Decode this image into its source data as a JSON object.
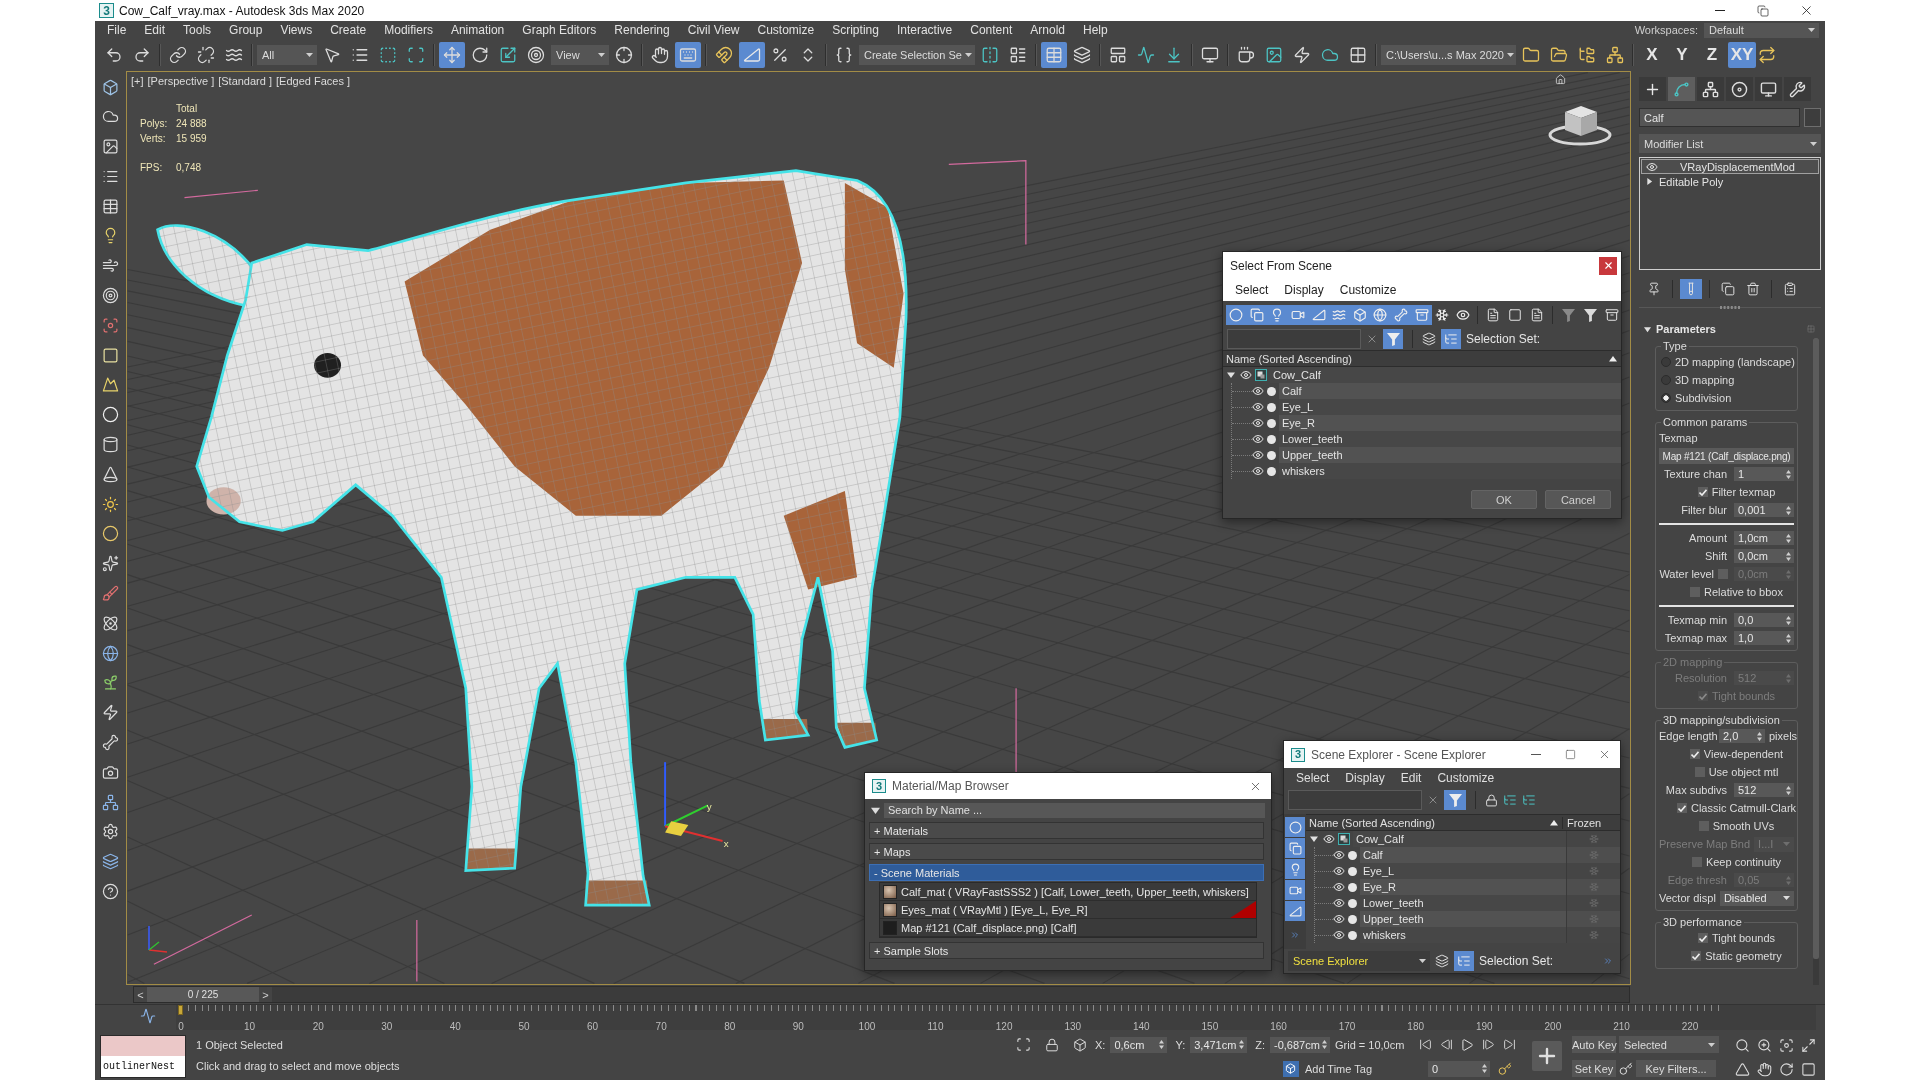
{
  "window": {
    "logo": "3",
    "title": "Cow_Calf_vray.max - Autodesk 3ds Max 2020"
  },
  "menu": [
    "File",
    "Edit",
    "Tools",
    "Group",
    "Views",
    "Create",
    "Modifiers",
    "Animation",
    "Graph Editors",
    "Rendering",
    "Civil View",
    "Customize",
    "Scripting",
    "Interactive",
    "Content",
    "Arnold",
    "Help"
  ],
  "workspaces": {
    "label": "Workspaces:",
    "value": "Default"
  },
  "toolbar": [
    {
      "kind": "button",
      "selected": false
    },
    {
      "kind": "button",
      "selected": false
    },
    {
      "kind": "separator"
    },
    {
      "kind": "button",
      "selected": false
    },
    {
      "kind": "button",
      "selected": false
    },
    {
      "kind": "button",
      "selected": false
    },
    {
      "kind": "separator"
    },
    {
      "kind": "dropdown",
      "value": "All"
    },
    {
      "kind": "button",
      "selected": false
    },
    {
      "kind": "button",
      "selected": false
    },
    {
      "kind": "button",
      "selected": false
    },
    {
      "kind": "button",
      "selected": false
    },
    {
      "kind": "separator"
    },
    {
      "kind": "button",
      "selected": true
    },
    {
      "kind": "button",
      "selected": false
    },
    {
      "kind": "button",
      "selected": false
    },
    {
      "kind": "button",
      "selected": false
    },
    {
      "kind": "dropdown",
      "value": "View"
    },
    {
      "kind": "button",
      "selected": false
    },
    {
      "kind": "separator"
    },
    {
      "kind": "button",
      "selected": false
    },
    {
      "kind": "button",
      "selected": true
    },
    {
      "kind": "separator"
    },
    {
      "kind": "button",
      "selected": false
    },
    {
      "kind": "button",
      "selected": true
    },
    {
      "kind": "button",
      "selected": false
    },
    {
      "kind": "button",
      "selected": false
    },
    {
      "kind": "separator"
    },
    {
      "kind": "button",
      "selected": false
    },
    {
      "kind": "dropdown",
      "value": "Create Selection Se"
    },
    {
      "kind": "button",
      "selected": false
    },
    {
      "kind": "button",
      "selected": false
    },
    {
      "kind": "separator"
    },
    {
      "kind": "button",
      "selected": true
    },
    {
      "kind": "button",
      "selected": false
    },
    {
      "kind": "separator"
    },
    {
      "kind": "button",
      "selected": false
    },
    {
      "kind": "button",
      "selected": false
    },
    {
      "kind": "button",
      "selected": false
    },
    {
      "kind": "separator"
    },
    {
      "kind": "button",
      "selected": false
    },
    {
      "kind": "separator"
    },
    {
      "kind": "button",
      "selected": false
    },
    {
      "kind": "button",
      "selected": false
    },
    {
      "kind": "button",
      "selected": false
    },
    {
      "kind": "button",
      "selected": false
    },
    {
      "kind": "button",
      "selected": false
    },
    {
      "kind": "separator"
    },
    {
      "kind": "dropdown",
      "value": "C:\\Users\\u...s Max 2020"
    },
    {
      "kind": "button",
      "selected": false
    },
    {
      "kind": "button",
      "selected": false
    },
    {
      "kind": "button",
      "selected": false
    },
    {
      "kind": "button",
      "selected": false
    },
    {
      "kind": "separator"
    }
  ],
  "axis_constraints": [
    {
      "label": "X",
      "selected": false
    },
    {
      "label": "Y",
      "selected": false
    },
    {
      "label": "Z",
      "selected": false
    },
    {
      "label": "XY",
      "selected": true
    }
  ],
  "viewport": {
    "labels": [
      "[+]",
      "[Perspective ]",
      "[Standard ]",
      "[Edged Faces ]"
    ],
    "stats": {
      "title": "Total",
      "rows": [
        {
          "label": "Polys:",
          "value": "24 888"
        },
        {
          "label": "Verts:",
          "value": "15 959"
        }
      ],
      "fps": {
        "label": "FPS:",
        "value": "0,748"
      }
    },
    "gizmo": {
      "labels": [
        "y",
        "x"
      ]
    }
  },
  "command_panel": {
    "tabs": [
      {
        "selected": false
      },
      {
        "selected": true
      },
      {
        "selected": false
      },
      {
        "selected": false
      },
      {
        "selected": false
      },
      {
        "selected": false
      }
    ],
    "object_name": "Calf",
    "modifier_list": "Modifier List",
    "stack": [
      {
        "kind": "modifier",
        "label": "VRayDisplacementMod",
        "selected": true
      },
      {
        "kind": "object",
        "label": "Editable Poly",
        "selected": false
      }
    ],
    "stack_tools": [
      {
        "selected": false
      },
      {
        "selected": true
      },
      {
        "selected": false
      },
      {
        "selected": false
      },
      {
        "selected": false
      }
    ],
    "rollout": {
      "title": "Parameters",
      "expanded": true
    },
    "groups": [
      {
        "title": "Type",
        "disabled": false,
        "items": [
          {
            "kind": "radio",
            "label": "2D mapping (landscape)",
            "selected": false,
            "disabled": false
          },
          {
            "kind": "radio",
            "label": "3D mapping",
            "selected": false,
            "disabled": false
          },
          {
            "kind": "radio",
            "label": "Subdivision",
            "selected": true,
            "disabled": false
          }
        ]
      },
      {
        "title": "Common params",
        "disabled": false,
        "items": [
          {
            "kind": "label",
            "text": "Texmap",
            "disabled": false
          },
          {
            "kind": "map",
            "label": "Map #121 (Calf_displace.png)",
            "disabled": false
          },
          {
            "kind": "spinner",
            "label": "Texture chan",
            "value": "1",
            "disabled": false
          },
          {
            "kind": "checkbox",
            "label": "Filter texmap",
            "checked": true,
            "disabled": false
          },
          {
            "kind": "spinner",
            "label": "Filter blur",
            "value": "0,001",
            "disabled": false
          },
          {
            "kind": "rule"
          },
          {
            "kind": "spinner",
            "label": "Amount",
            "value": "1,0cm",
            "disabled": false
          },
          {
            "kind": "spinner",
            "label": "Shift",
            "value": "0,0cm",
            "disabled": false
          },
          {
            "kind": "check_spinner",
            "label": "Water level",
            "checked": false,
            "value": "0,0cm",
            "disabled": true
          },
          {
            "kind": "checkbox",
            "label": "Relative to bbox",
            "checked": false,
            "disabled": false
          },
          {
            "kind": "rule"
          },
          {
            "kind": "spinner",
            "label": "Texmap min",
            "value": "0,0",
            "disabled": false
          },
          {
            "kind": "spinner",
            "label": "Texmap max",
            "value": "1,0",
            "disabled": false
          }
        ]
      },
      {
        "title": "2D mapping",
        "disabled": true,
        "items": [
          {
            "kind": "spinner",
            "label": "Resolution",
            "value": "512",
            "disabled": true
          },
          {
            "kind": "checkbox",
            "label": "Tight bounds",
            "checked": true,
            "disabled": true
          }
        ]
      },
      {
        "title": "3D mapping/subdivision",
        "disabled": false,
        "items": [
          {
            "kind": "spinner",
            "label": "Edge length",
            "value": "2,0",
            "unit": "pixels",
            "disabled": false
          },
          {
            "kind": "checkbox",
            "label": "View-dependent",
            "checked": true,
            "disabled": false
          },
          {
            "kind": "checkbox",
            "label": "Use object mtl",
            "checked": false,
            "disabled": false
          },
          {
            "kind": "spinner",
            "label": "Max subdivs",
            "value": "512",
            "disabled": false
          },
          {
            "kind": "checkbox",
            "label": "Classic Catmull-Clark",
            "checked": true,
            "disabled": false
          },
          {
            "kind": "checkbox",
            "label": "Smooth UVs",
            "checked": false,
            "disabled": false
          },
          {
            "kind": "dropdown",
            "label": "Preserve Map Bnd",
            "value": "I...I",
            "disabled": true
          },
          {
            "kind": "checkbox",
            "label": "Keep continuity",
            "checked": false,
            "disabled": false
          },
          {
            "kind": "spinner",
            "label": "Edge thresh",
            "value": "0,05",
            "disabled": true
          },
          {
            "kind": "dropdown",
            "label": "Vector displ",
            "value": "Disabled",
            "disabled": false
          }
        ]
      },
      {
        "title": "3D performance",
        "disabled": false,
        "items": [
          {
            "kind": "checkbox",
            "label": "Tight bounds",
            "checked": true,
            "disabled": false
          },
          {
            "kind": "checkbox",
            "label": "Static geometry",
            "checked": true,
            "disabled": false
          }
        ]
      }
    ]
  },
  "select_from_scene": {
    "title": "Select From Scene",
    "menu": [
      "Select",
      "Display",
      "Customize"
    ],
    "type_filters": [
      {
        "selected": true
      },
      {
        "selected": true
      },
      {
        "selected": true
      },
      {
        "selected": true
      },
      {
        "selected": true
      },
      {
        "selected": true
      },
      {
        "selected": true
      },
      {
        "selected": true
      },
      {
        "selected": true
      },
      {
        "selected": true
      },
      {
        "selected": false
      },
      {
        "selected": false
      }
    ],
    "filter_toggle": {
      "selected": true
    },
    "hierarchy_toggle": {
      "selected": true
    },
    "selection_set_label": "Selection Set:",
    "column": "Name (Sorted Ascending)",
    "tree": [
      {
        "name": "Cow_Calf",
        "selected": false,
        "expanded": true,
        "children": [
          {
            "name": "Calf",
            "selected": false
          },
          {
            "name": "Eye_L",
            "selected": false
          },
          {
            "name": "Eye_R",
            "selected": false
          },
          {
            "name": "Lower_teeth",
            "selected": false
          },
          {
            "name": "Upper_teeth",
            "selected": false
          },
          {
            "name": "whiskers",
            "selected": false
          }
        ]
      }
    ],
    "buttons": [
      "OK",
      "Cancel"
    ]
  },
  "material_browser": {
    "logo": "3",
    "title": "Material/Map Browser",
    "search_placeholder": "Search by Name ...",
    "sections": [
      {
        "label": "+ Materials",
        "selected": false
      },
      {
        "label": "+ Maps",
        "selected": false
      },
      {
        "label": "- Scene Materials",
        "selected": true,
        "items": [
          {
            "kind": "material",
            "label": "Calf_mat ( VRayFastSSS2 ) [Calf, Lower_teeth, Upper_teeth, whiskers]",
            "marked": false
          },
          {
            "kind": "material",
            "label": "Eyes_mat ( VRayMtl ) [Eye_L, Eye_R]",
            "marked": true
          },
          {
            "kind": "map",
            "label": "Map #121 (Calf_displace.png) [Calf]",
            "marked": false
          }
        ]
      },
      {
        "label": "+ Sample Slots",
        "selected": false
      }
    ]
  },
  "scene_explorer": {
    "logo": "3",
    "title": "Scene Explorer - Scene Explorer",
    "menu": [
      "Select",
      "Display",
      "Edit",
      "Customize"
    ],
    "filter_toggle": {
      "selected": true
    },
    "side_filters": [
      {
        "selected": true
      },
      {
        "selected": true
      },
      {
        "selected": true
      },
      {
        "selected": true
      },
      {
        "selected": true
      }
    ],
    "columns": [
      "Name (Sorted Ascending)",
      "Frozen"
    ],
    "tree": [
      {
        "name": "Cow_Calf",
        "selected": false,
        "frozen": false,
        "expanded": true,
        "children": [
          {
            "name": "Calf",
            "selected": false,
            "frozen": false
          },
          {
            "name": "Eye_L",
            "selected": false,
            "frozen": false
          },
          {
            "name": "Eye_R",
            "selected": false,
            "frozen": false
          },
          {
            "name": "Lower_teeth",
            "selected": false,
            "frozen": false
          },
          {
            "name": "Upper_teeth",
            "selected": false,
            "frozen": false
          },
          {
            "name": "whiskers",
            "selected": false,
            "frozen": false
          }
        ]
      }
    ],
    "explorer": "Scene Explorer",
    "hierarchy_toggle": {
      "selected": true
    },
    "selection_set_label": "Selection Set:"
  },
  "time_slider": {
    "prev": "<",
    "label": "0 / 225",
    "next": ">",
    "level": 0
  },
  "trackbar": {
    "ticks": [
      "0",
      "10",
      "20",
      "30",
      "40",
      "50",
      "60",
      "70",
      "80",
      "90",
      "100",
      "110",
      "120",
      "130",
      "140",
      "150",
      "160",
      "170",
      "180",
      "190",
      "200",
      "210",
      "220"
    ]
  },
  "status": {
    "listener": "outlinerNest",
    "selection": "1 Object Selected",
    "prompt": "Click and drag to select and move objects",
    "coords": [
      {
        "label": "X:",
        "value": "0,6cm"
      },
      {
        "label": "Y:",
        "value": "3,471cm"
      },
      {
        "label": "Z:",
        "value": "-0,687cm"
      }
    ],
    "grid": "Grid = 10,0cm",
    "time_tag": "Add Time Tag",
    "frame": "0",
    "auto_key": {
      "label": "Auto Key",
      "selected": false
    },
    "set_key": "Set Key",
    "key_mode": "Selected",
    "key_filters": "Key Filters..."
  }
}
